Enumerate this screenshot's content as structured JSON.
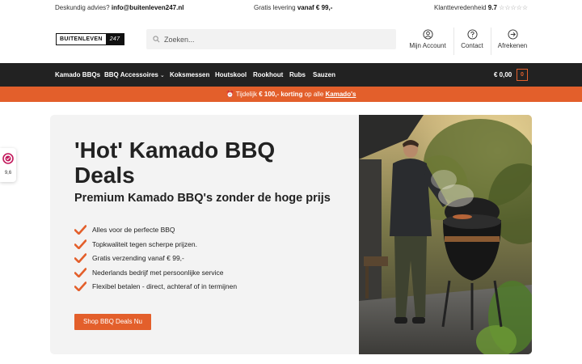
{
  "topbar": {
    "advice_label": "Deskundig advies?",
    "email": "info@buitenleven247.nl",
    "shipping_label": "Gratis levering",
    "shipping_value": "vanaf € 99,-",
    "satisfaction_label": "Klanttevredenheid",
    "satisfaction_score": "9.7",
    "stars": "☆☆☆☆☆"
  },
  "logo": {
    "part1": "BUITENLEVEN",
    "part2": "247"
  },
  "search": {
    "placeholder": "Zoeken..."
  },
  "header_icons": [
    {
      "label": "Mijn Account",
      "icon": "account-icon"
    },
    {
      "label": "Contact",
      "icon": "help-icon"
    },
    {
      "label": "Afrekenen",
      "icon": "checkout-arrow-icon"
    }
  ],
  "nav": {
    "items": [
      {
        "label": "Kamado BBQs"
      },
      {
        "label": "BBQ Accessoires",
        "has_dropdown": true
      },
      {
        "label": "Koksmessen"
      },
      {
        "label": "Houtskool"
      },
      {
        "label": "Rookhout"
      },
      {
        "label": "Rubs"
      },
      {
        "label": "Sauzen"
      }
    ],
    "cart_total": "€ 0,00",
    "cart_count": "0"
  },
  "promo": {
    "icon": "⏰",
    "prefix": "Tijdelijk",
    "amount": "€ 100,- korting",
    "middle": "op alle",
    "link": "Kamado's"
  },
  "side_badge": {
    "rating": "9,6"
  },
  "hero": {
    "title": "'Hot' Kamado BBQ Deals",
    "subtitle": "Premium Kamado BBQ's zonder de hoge prijs",
    "features": [
      "Alles voor de perfecte BBQ",
      "Topkwaliteit tegen scherpe prijzen.",
      "Gratis verzending vanaf € 99,-",
      "Nederlands bedrijf met persoonlijke service",
      "Flexibel betalen - direct, achteraf of in termijnen"
    ],
    "cta_label": "Shop BBQ Deals Nu"
  },
  "colors": {
    "accent": "#e35f2b",
    "nav_bg": "#222222",
    "hero_bg": "#f3f3f3"
  }
}
